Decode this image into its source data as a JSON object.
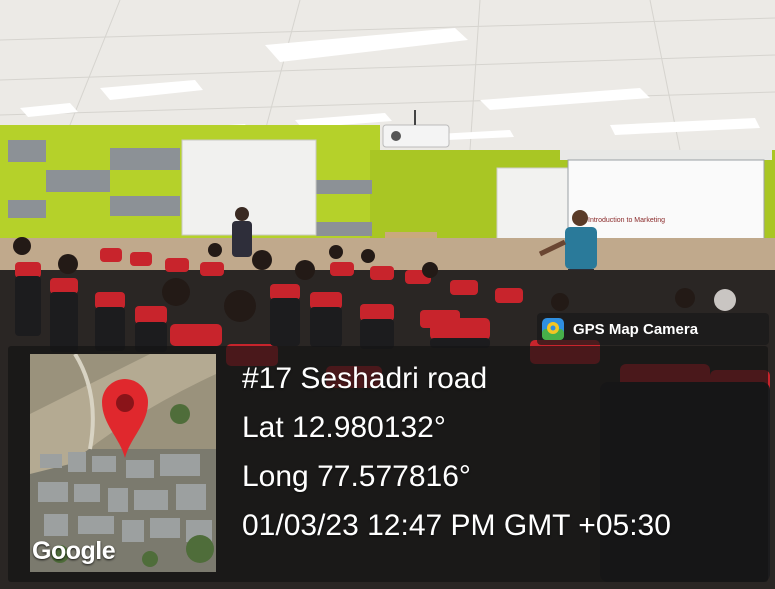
{
  "badge": {
    "label": "GPS Map Camera",
    "icon": "gps-map-camera-app-icon"
  },
  "map": {
    "logo_text": "Google",
    "pin_icon": "map-pin-icon",
    "pin_color": "#e0282d"
  },
  "location": {
    "address": "#17 Seshadri road",
    "lat": "Lat 12.980132°",
    "long": "Long 77.577816°",
    "datetime": "01/03/23 12:47 PM GMT +05:30"
  },
  "slide": {
    "text": "Introduction to Marketing"
  },
  "colors": {
    "wall_green": "#b5d12a",
    "seat_red": "#c8242c",
    "speaker_shirt": "#2a7a9a"
  }
}
